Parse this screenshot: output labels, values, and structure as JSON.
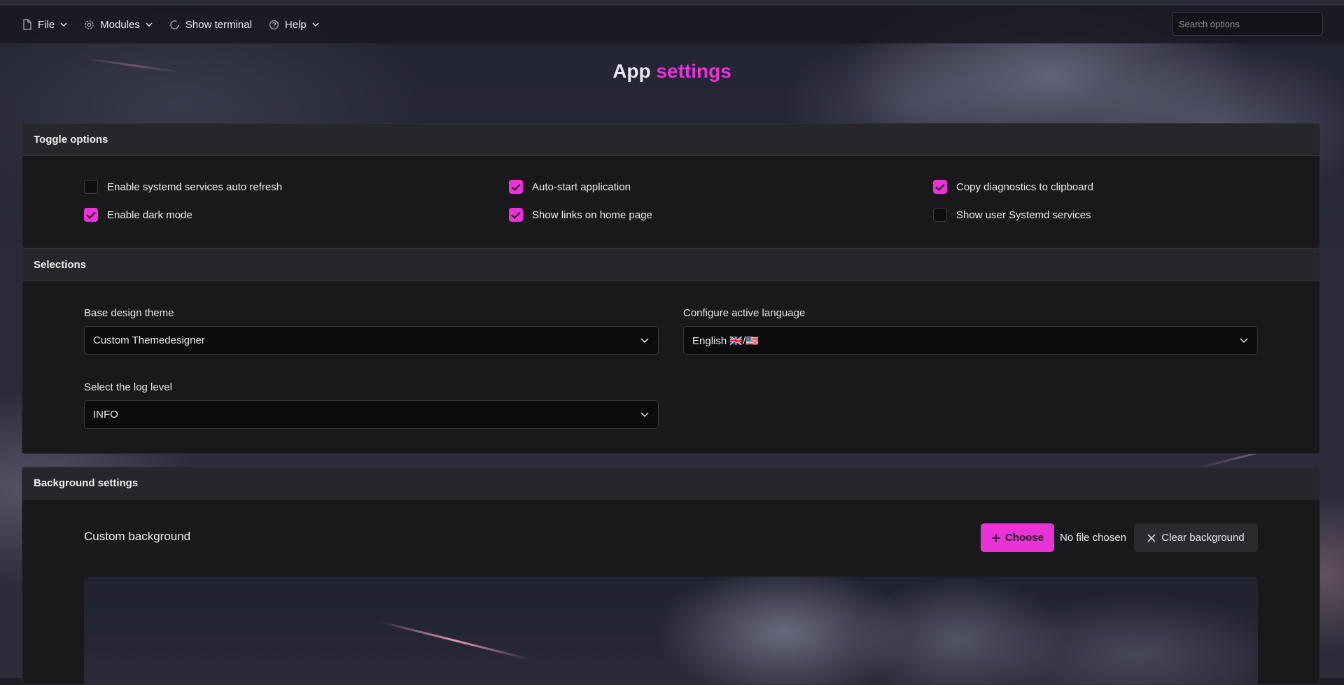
{
  "menu": {
    "file": "File",
    "modules": "Modules",
    "terminal": "Show terminal",
    "help": "Help"
  },
  "search": {
    "placeholder": "Search options"
  },
  "title": {
    "main": "App",
    "accent": "settings"
  },
  "toggle_panel": {
    "title": "Toggle options",
    "options": [
      {
        "label": "Enable systemd services auto refresh",
        "checked": false
      },
      {
        "label": "Auto-start application",
        "checked": true
      },
      {
        "label": "Copy diagnostics to clipboard",
        "checked": true
      },
      {
        "label": "Enable dark mode",
        "checked": true
      },
      {
        "label": "Show links on home page",
        "checked": true
      },
      {
        "label": "Show user Systemd services",
        "checked": false
      }
    ]
  },
  "selection_panel": {
    "title": "Selections",
    "theme": {
      "label": "Base design theme",
      "value": "Custom Themedesigner"
    },
    "language": {
      "label": "Configure active language",
      "value": "English 🇬🇧/🇺🇸"
    },
    "log_level": {
      "label": "Select the log level",
      "value": "INFO"
    }
  },
  "background_panel": {
    "title": "Background settings",
    "label": "Custom background",
    "choose": "Choose",
    "no_file": "No file chosen",
    "clear": "Clear background"
  },
  "colors": {
    "accent": "#ea33d6",
    "panel": "#19191c",
    "panel_header": "#27272b"
  }
}
